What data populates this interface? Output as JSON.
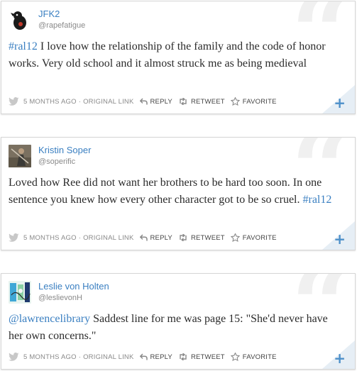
{
  "tweets": [
    {
      "name": "JFK2",
      "handle": "@rapefatigue",
      "avatar": "black-crow-avatar",
      "text_parts": [
        {
          "t": "#ral12",
          "link": true
        },
        {
          "t": " I love how the relationship of the family and the code of honor works. Very old school and it almost struck me as being medieval",
          "link": false
        }
      ],
      "time": "5 MONTHS AGO",
      "original_link": "ORIGINAL LINK",
      "reply": "REPLY",
      "retweet": "RETWEET",
      "favorite": "FAVORITE"
    },
    {
      "name": "Kristin Soper",
      "handle": "@soperific",
      "avatar": "photo-avatar",
      "text_parts": [
        {
          "t": "Loved how Ree did not want her brothers to be hard too soon. In one sentence you knew how every other character got to be so cruel. ",
          "link": false
        },
        {
          "t": "#ral12",
          "link": true
        }
      ],
      "time": "5 MONTHS AGO",
      "original_link": "ORIGINAL LINK",
      "reply": "REPLY",
      "retweet": "RETWEET",
      "favorite": "FAVORITE"
    },
    {
      "name": "Leslie von Holten",
      "handle": "@leslievonH",
      "avatar": "drawing-avatar",
      "text_parts": [
        {
          "t": "@lawrencelibrary",
          "link": true
        },
        {
          "t": " Saddest line for me was page 15: \"She'd never have her own concerns.\"",
          "link": false
        }
      ],
      "time": "5 MONTHS AGO",
      "original_link": "ORIGINAL LINK",
      "reply": "REPLY",
      "retweet": "RETWEET",
      "favorite": "FAVORITE"
    }
  ],
  "footer_separator": "·",
  "quote_glyph": "“",
  "plus_glyph": "+",
  "colors": {
    "link": "#3a7fc1",
    "meta": "#8a8a8a",
    "border": "#d6d6d6"
  }
}
